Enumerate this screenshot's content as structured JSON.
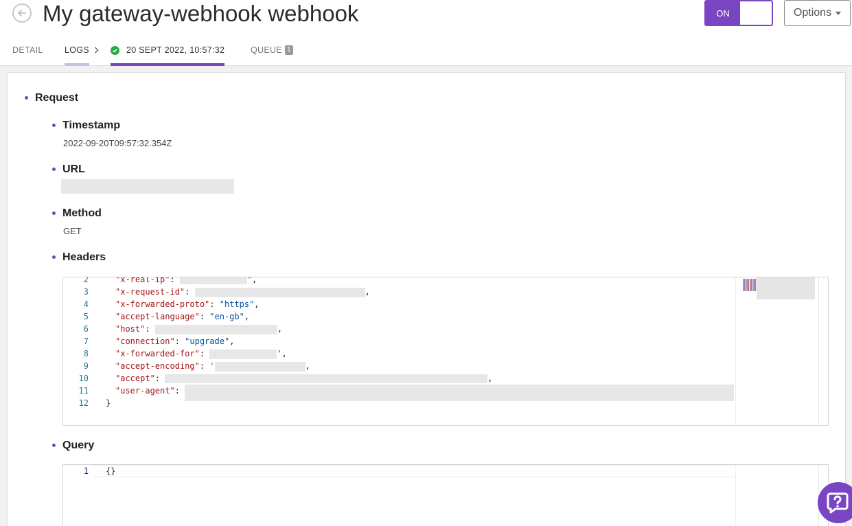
{
  "header": {
    "title": "My gateway-webhook webhook",
    "toggle_label": "ON",
    "options_label": "Options"
  },
  "tabs": {
    "detail": "DETAIL",
    "logs": "LOGS",
    "entry": "20 SEPT 2022, 10:57:32",
    "queue": "QUEUE",
    "queue_count": "1"
  },
  "request": {
    "label": "Request",
    "timestamp_label": "Timestamp",
    "timestamp_value": "2022-09-20T09:57:32.354Z",
    "url_label": "URL",
    "method_label": "Method",
    "method_value": "GET",
    "headers_label": "Headers",
    "query_label": "Query"
  },
  "headers_code": {
    "lines": [
      {
        "n": "2",
        "key": "\"x-real-ip\"",
        "sep": ": ",
        "val": "",
        "end": "\","
      },
      {
        "n": "3",
        "key": "\"x-request-id\"",
        "sep": ": ",
        "val": "",
        "end": ","
      },
      {
        "n": "4",
        "key": "\"x-forwarded-proto\"",
        "sep": ": ",
        "val": "\"https\"",
        "end": ","
      },
      {
        "n": "5",
        "key": "\"accept-language\"",
        "sep": ": ",
        "val": "\"en-gb\"",
        "end": ","
      },
      {
        "n": "6",
        "key": "\"host\"",
        "sep": ": ",
        "val": "",
        "end": ","
      },
      {
        "n": "7",
        "key": "\"connection\"",
        "sep": ": ",
        "val": "\"upgrade\"",
        "end": ","
      },
      {
        "n": "8",
        "key": "\"x-forwarded-for\"",
        "sep": ": ",
        "val": "",
        "end": "',"
      },
      {
        "n": "9",
        "key": "\"accept-encoding\"",
        "sep": ": ",
        "val": "'",
        "end": ","
      },
      {
        "n": "10",
        "key": "\"accept\"",
        "sep": ": ",
        "val": "",
        "end": ","
      },
      {
        "n": "11",
        "key": "\"user-agent\"",
        "sep": ": ",
        "val": "",
        "end": ""
      },
      {
        "n": "12",
        "key": "}",
        "sep": "",
        "val": "",
        "end": ""
      }
    ]
  },
  "query_code": {
    "line_no": "1",
    "text": "{}"
  },
  "colors": {
    "accent": "#7a45c2",
    "success": "#27a844",
    "code_key": "#a31515",
    "code_string": "#0451a5",
    "line_number": "#237893"
  },
  "icons": {
    "back": "arrow-left-circle-icon",
    "success": "check-circle-icon",
    "chevron": "chevron-right-icon",
    "help": "help-chat-icon"
  }
}
